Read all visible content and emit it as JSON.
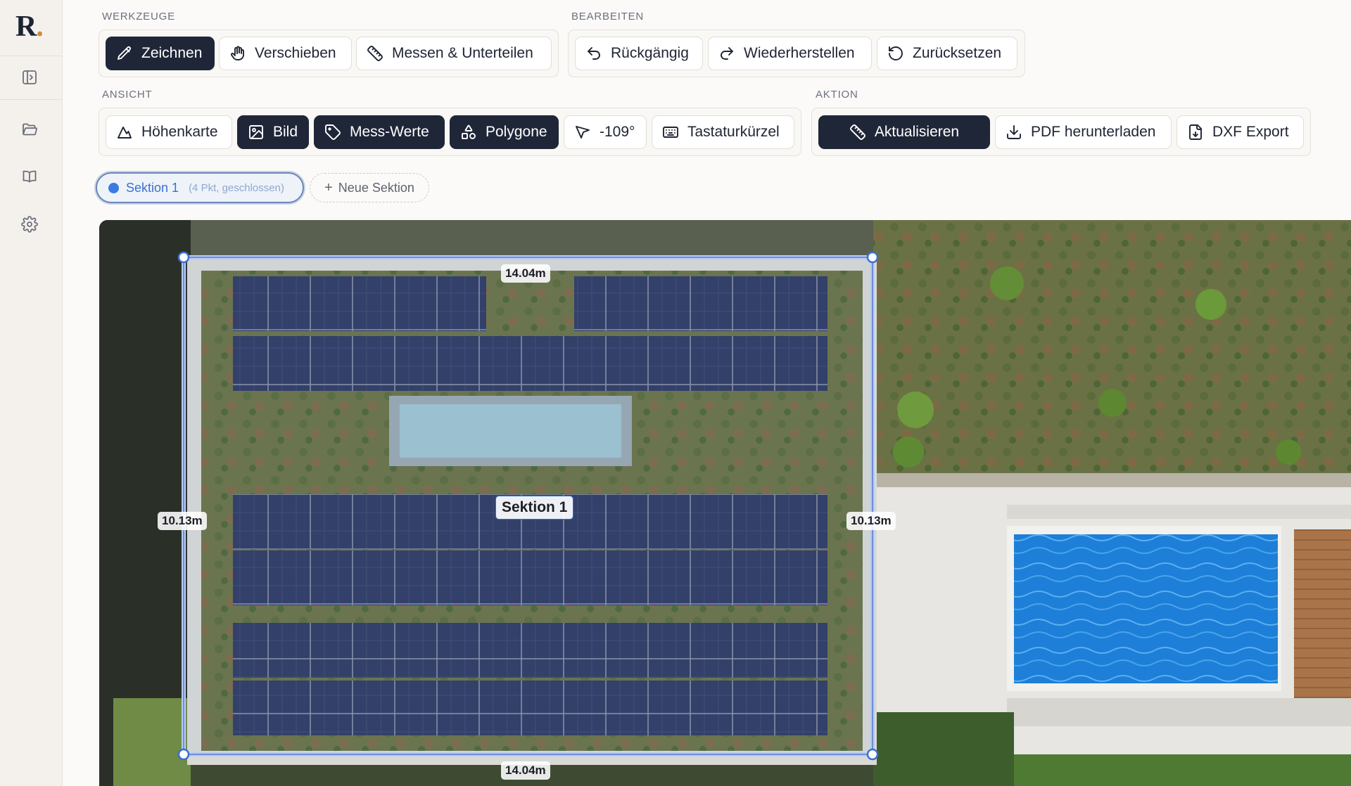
{
  "app": {
    "logo_letter": "R",
    "logo_dot": "."
  },
  "sidebar": {
    "icons": [
      "sidebar-toggle-icon",
      "folder-icon",
      "book-icon",
      "gear-icon"
    ]
  },
  "toolbar": {
    "werkzeuge": {
      "label": "WERKZEUGE",
      "draw": "Zeichnen",
      "pan": "Verschieben",
      "measure": "Messen & Unterteilen"
    },
    "bearbeiten": {
      "label": "BEARBEITEN",
      "undo": "Rückgängig",
      "redo": "Wiederherstellen",
      "reset": "Zurücksetzen"
    },
    "ansicht": {
      "label": "ANSICHT",
      "heightmap": "Höhenkarte",
      "image": "Bild",
      "measurements": "Mess-Werte",
      "polygons": "Polygone",
      "rotation": "-109°",
      "shortcuts": "Tastaturkürzel"
    },
    "aktion": {
      "label": "AKTION",
      "refresh": "Aktualisieren",
      "pdf": "PDF herunterladen",
      "dxf": "DXF Export"
    }
  },
  "sections": {
    "active": {
      "name": "Sektion 1",
      "meta": "(4 Pkt, geschlossen)"
    },
    "new_label": "Neue Sektion"
  },
  "map": {
    "label_top": "14.04m",
    "label_bottom": "14.04m",
    "label_left": "10.13m",
    "label_right": "10.13m",
    "section_label": "Sektion 1"
  },
  "colors": {
    "accent_dark": "#1f2638",
    "section_blue": "#3b7be3",
    "logo_dot": "#d08a3a"
  }
}
